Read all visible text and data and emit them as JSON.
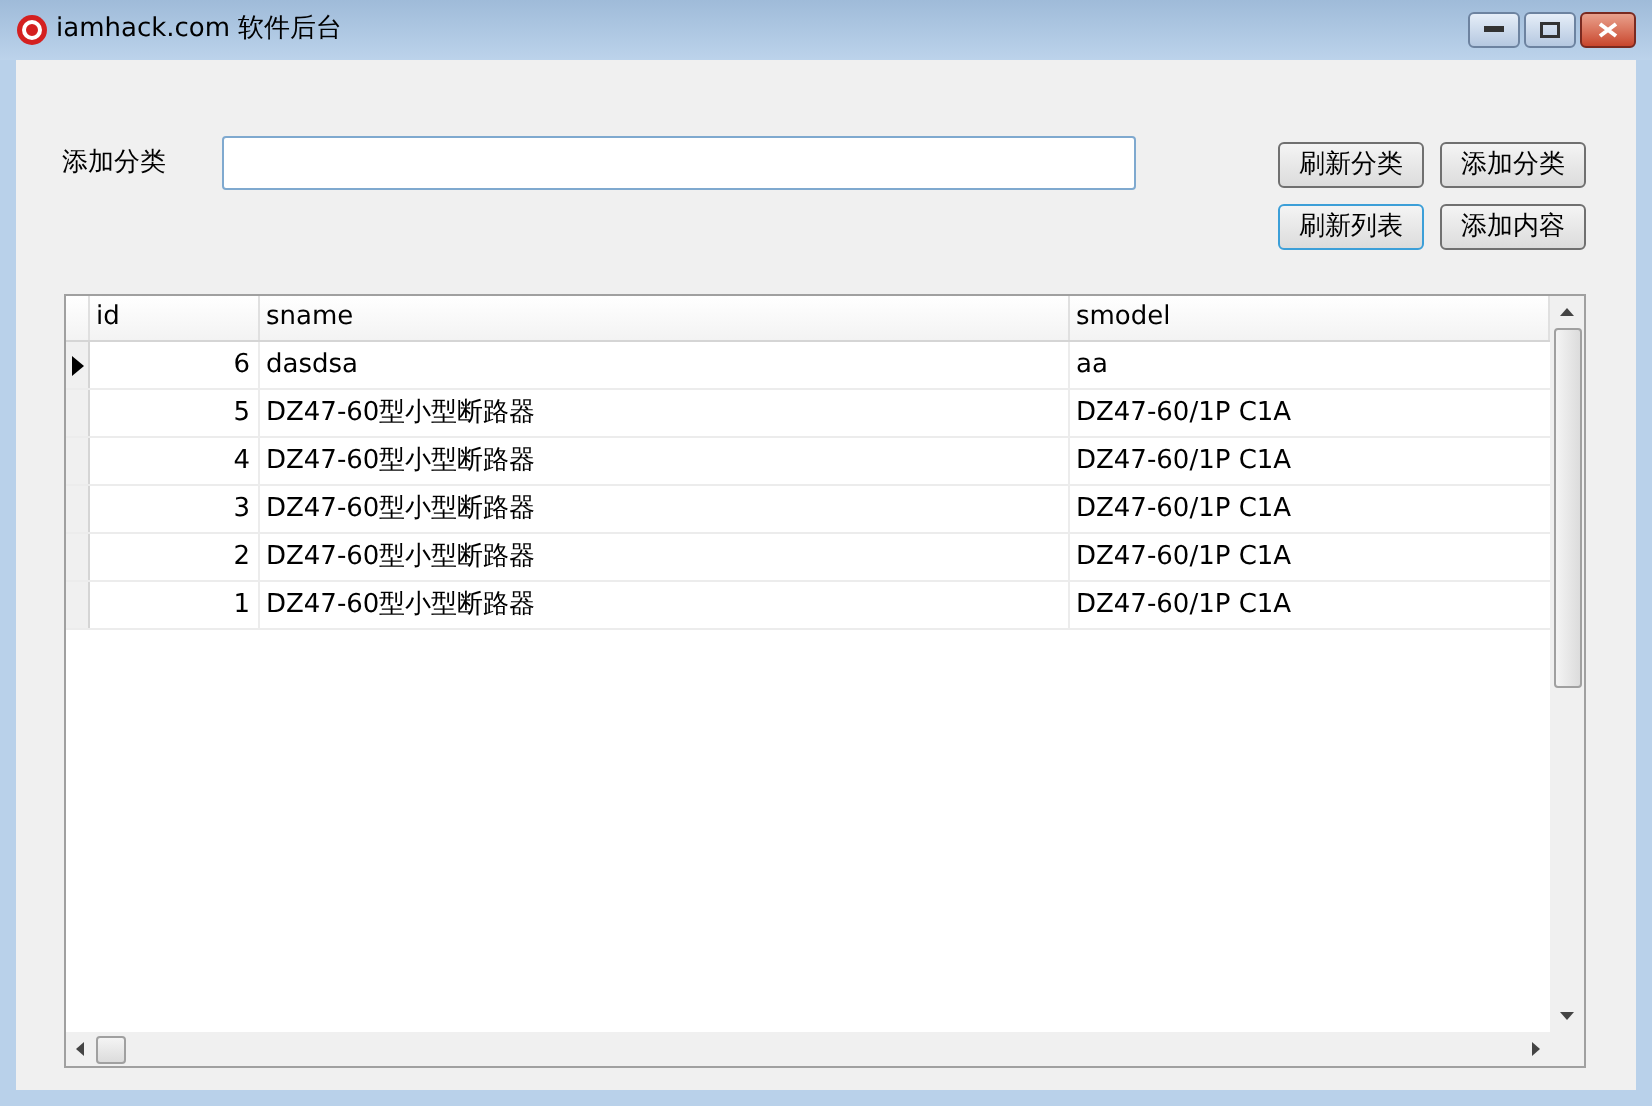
{
  "window": {
    "title": "iamhack.com 软件后台"
  },
  "form": {
    "label": "添加分类"
  },
  "buttons": [
    {
      "label": "刷新分类",
      "focused": false
    },
    {
      "label": "添加分类",
      "focused": false
    },
    {
      "label": "刷新列表",
      "focused": true
    },
    {
      "label": "添加内容",
      "focused": false
    }
  ],
  "table": {
    "columns": [
      "id",
      "sname",
      "smodel"
    ],
    "rows": [
      {
        "id": "6",
        "sname": "dasdsa",
        "smodel": "aa",
        "selected": true
      },
      {
        "id": "5",
        "sname": "DZ47-60型小型断路器",
        "smodel": "DZ47-60/1P C1A",
        "selected": false
      },
      {
        "id": "4",
        "sname": "DZ47-60型小型断路器",
        "smodel": "DZ47-60/1P C1A",
        "selected": false
      },
      {
        "id": "3",
        "sname": "DZ47-60型小型断路器",
        "smodel": "DZ47-60/1P C1A",
        "selected": false
      },
      {
        "id": "2",
        "sname": "DZ47-60型小型断路器",
        "smodel": "DZ47-60/1P C1A",
        "selected": false
      },
      {
        "id": "1",
        "sname": "DZ47-60型小型断路器",
        "smodel": "DZ47-60/1P C1A",
        "selected": false
      }
    ]
  }
}
